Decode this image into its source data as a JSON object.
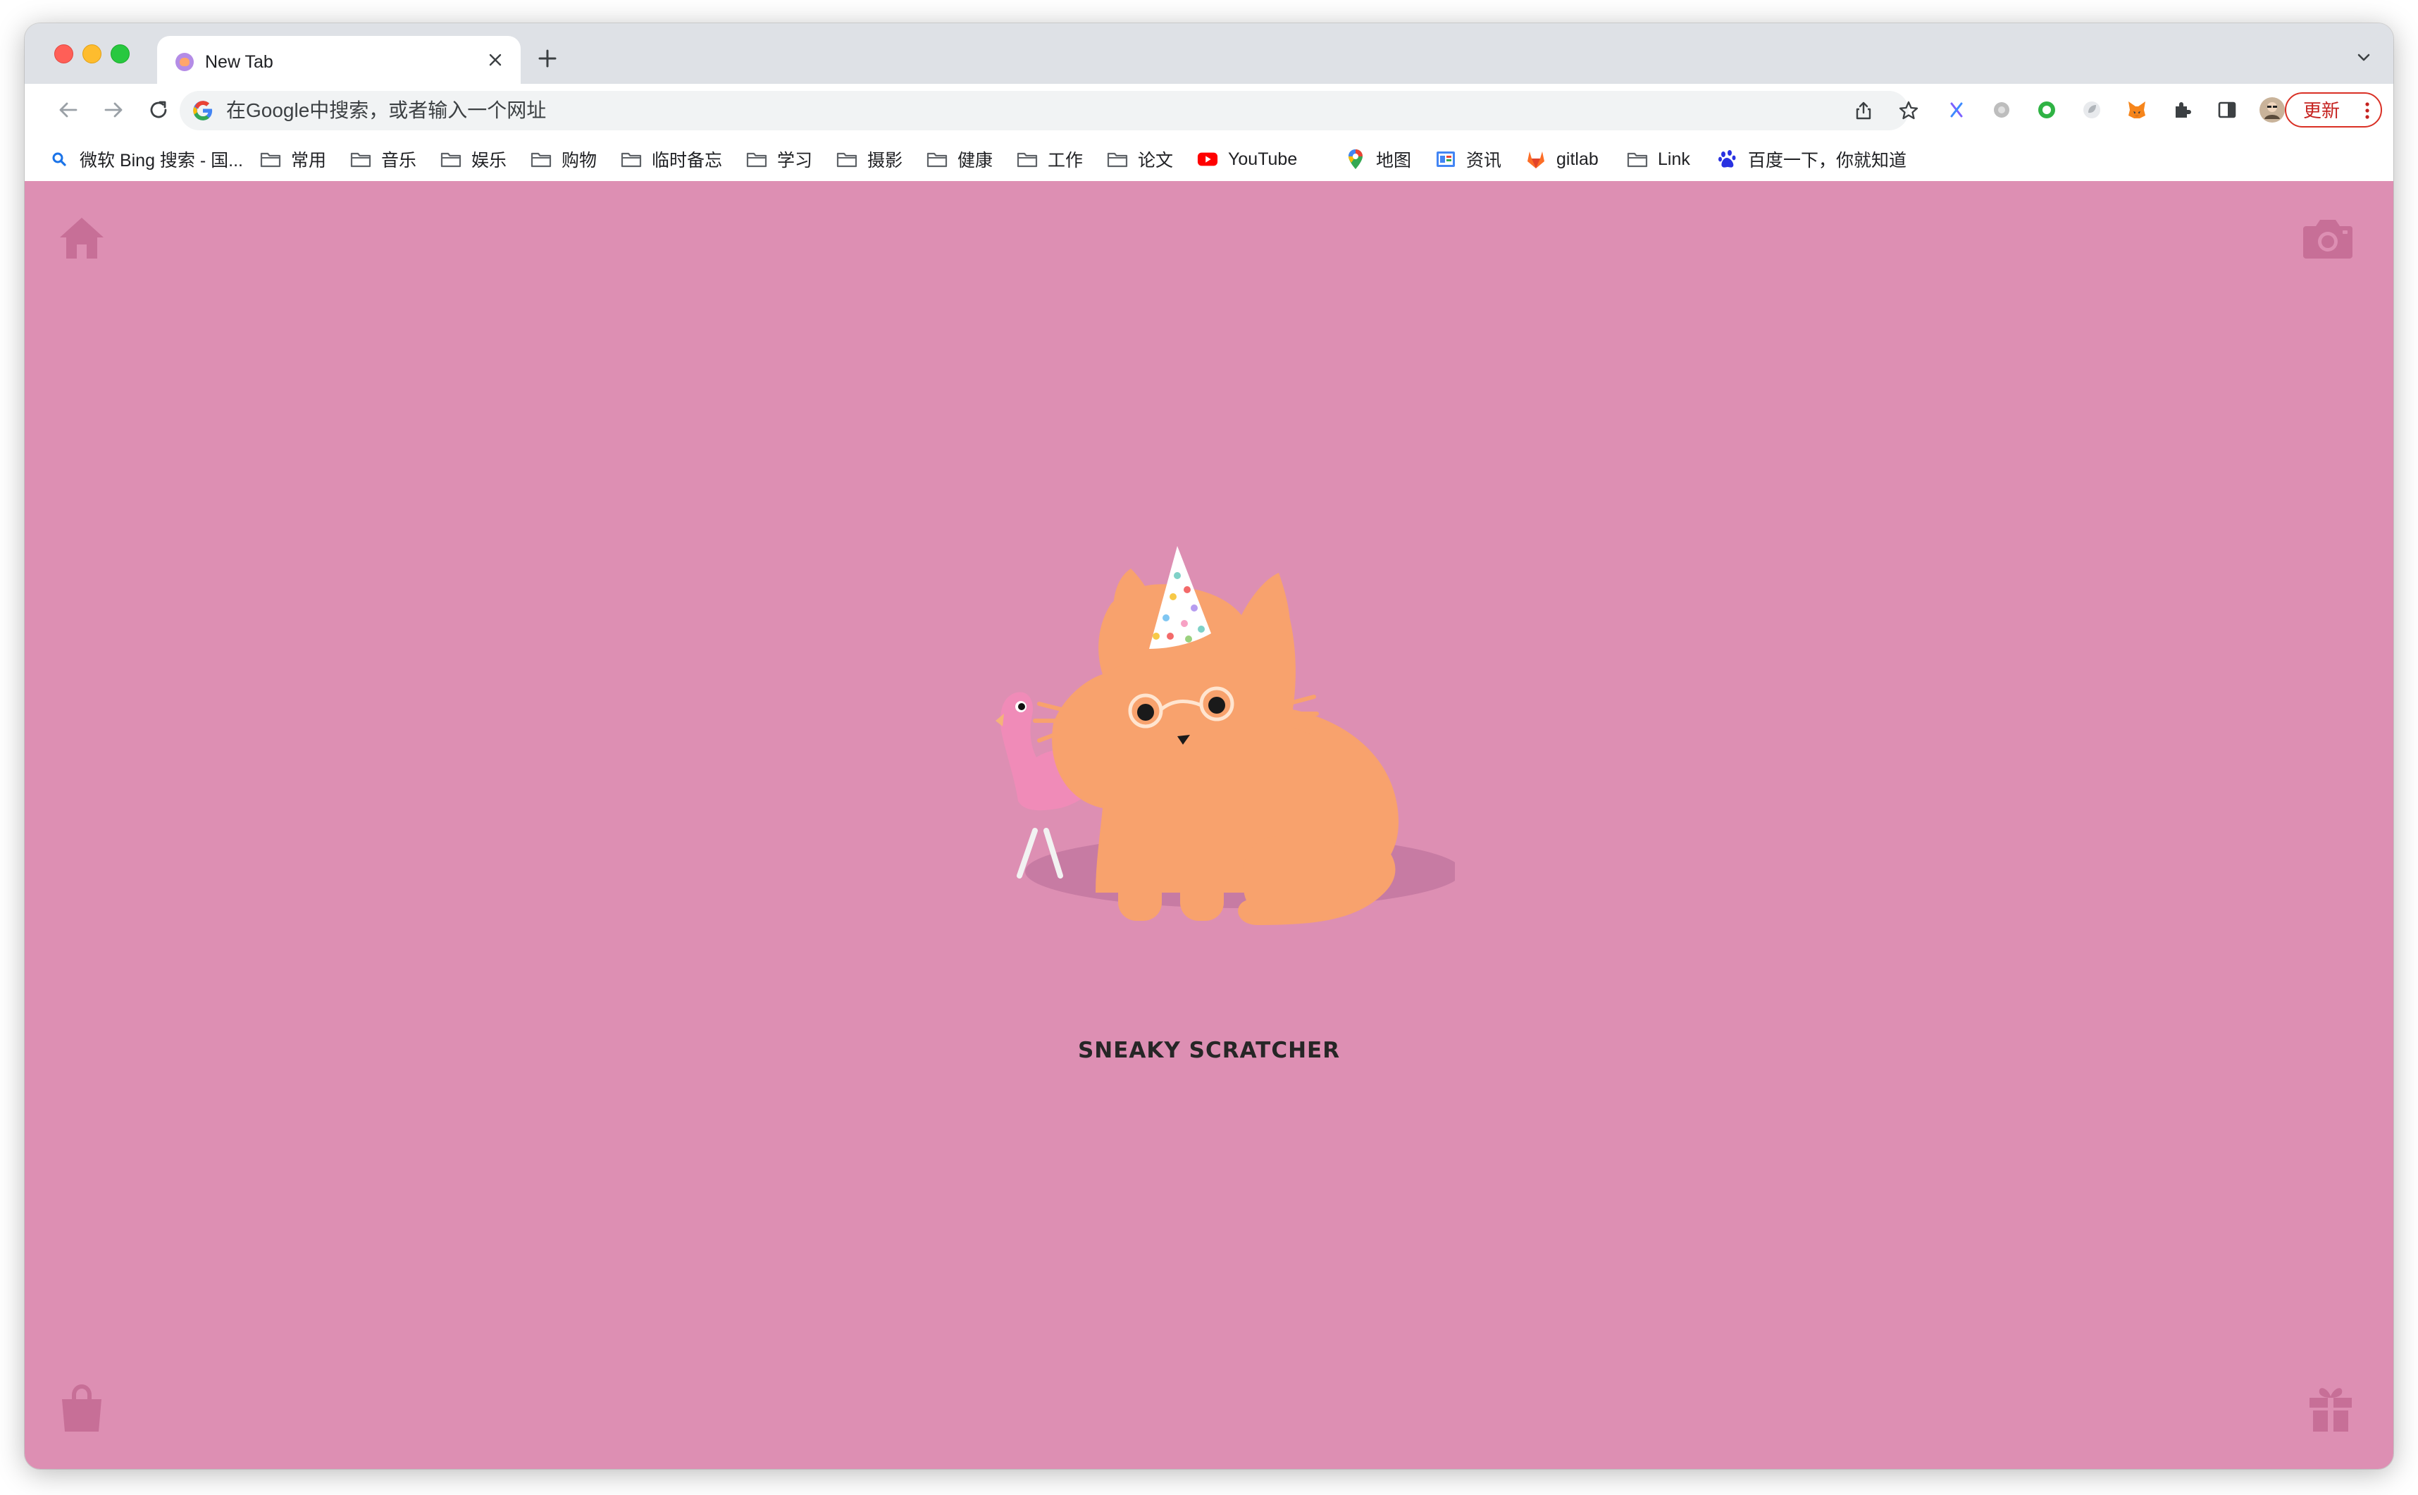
{
  "browser": {
    "tab": {
      "title": "New Tab"
    },
    "address_bar": {
      "placeholder": "在Google中搜索，或者输入一个网址"
    },
    "update_button": {
      "label": "更新"
    }
  },
  "bookmarks": [
    {
      "label": "微软 Bing 搜索 - 国...",
      "icon": "bing-search-icon"
    },
    {
      "label": "常用",
      "icon": "folder-icon"
    },
    {
      "label": "音乐",
      "icon": "folder-icon"
    },
    {
      "label": "娱乐",
      "icon": "folder-icon"
    },
    {
      "label": "购物",
      "icon": "folder-icon"
    },
    {
      "label": "临时备忘",
      "icon": "folder-icon"
    },
    {
      "label": "学习",
      "icon": "folder-icon"
    },
    {
      "label": "摄影",
      "icon": "folder-icon"
    },
    {
      "label": "健康",
      "icon": "folder-icon"
    },
    {
      "label": "工作",
      "icon": "folder-icon"
    },
    {
      "label": "论文",
      "icon": "folder-icon"
    },
    {
      "label": "YouTube",
      "icon": "youtube-icon"
    },
    {
      "label": "地图",
      "icon": "google-maps-icon"
    },
    {
      "label": "资讯",
      "icon": "google-news-icon"
    },
    {
      "label": "gitlab",
      "icon": "gitlab-icon"
    },
    {
      "label": "Link",
      "icon": "folder-icon"
    },
    {
      "label": "百度一下，你就知道",
      "icon": "baidu-icon"
    }
  ],
  "page": {
    "caption": "SNEAKY SCRATCHER",
    "background_color": "#dd8fb3",
    "cat_color": "#f8a26d",
    "flamingo_color": "#f08bb8"
  }
}
